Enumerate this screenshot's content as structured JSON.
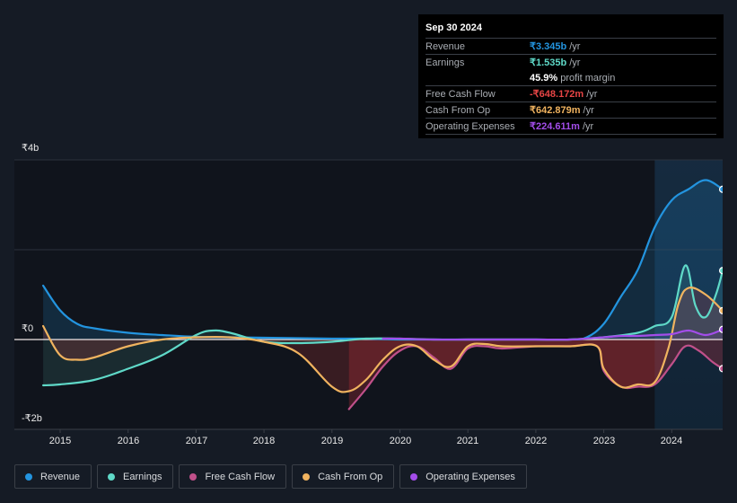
{
  "tooltip": {
    "date": "Sep 30 2024",
    "rows": [
      {
        "label": "Revenue",
        "value": "₹3.345b",
        "unit": "/yr",
        "color": "#2394df"
      },
      {
        "label": "Earnings",
        "value": "₹1.535b",
        "unit": "/yr",
        "color": "#5fd9c8"
      },
      {
        "label": "",
        "value": "45.9%",
        "unit": "profit margin",
        "color": "#ffffff"
      },
      {
        "label": "Free Cash Flow",
        "value": "-₹648.172m",
        "unit": "/yr",
        "color": "#e64545"
      },
      {
        "label": "Cash From Op",
        "value": "₹642.879m",
        "unit": "/yr",
        "color": "#f0b35f"
      },
      {
        "label": "Operating Expenses",
        "value": "₹224.611m",
        "unit": "/yr",
        "color": "#a34dea"
      }
    ]
  },
  "legend": [
    {
      "label": "Revenue",
      "color": "#2394df"
    },
    {
      "label": "Earnings",
      "color": "#5fd9c8"
    },
    {
      "label": "Free Cash Flow",
      "color": "#c0508a"
    },
    {
      "label": "Cash From Op",
      "color": "#f0b35f"
    },
    {
      "label": "Operating Expenses",
      "color": "#a34dea"
    }
  ],
  "chart_data": {
    "type": "line",
    "title": "",
    "xlabel": "",
    "ylabel": "",
    "y_unit": "INR billions",
    "ylim": [
      -2,
      4
    ],
    "xlim": [
      2014.4,
      2024.75
    ],
    "y_ticks": [
      {
        "value": 4,
        "label": "₹4b"
      },
      {
        "value": 0,
        "label": "₹0"
      },
      {
        "value": -2,
        "label": "-₹2b"
      }
    ],
    "x_ticks": [
      "2015",
      "2016",
      "2017",
      "2018",
      "2019",
      "2020",
      "2021",
      "2022",
      "2023",
      "2024"
    ],
    "highlight_from": 2023.75,
    "grid": true,
    "legend_position": "bottom-left",
    "series": [
      {
        "name": "Revenue",
        "color": "#2394df",
        "x": [
          2014.75,
          2015.0,
          2015.25,
          2015.5,
          2016.0,
          2016.5,
          2017.0,
          2017.5,
          2018.0,
          2018.5,
          2019.0,
          2019.5,
          2020.0,
          2020.5,
          2021.0,
          2021.5,
          2022.0,
          2022.5,
          2022.75,
          2023.0,
          2023.25,
          2023.5,
          2023.75,
          2024.0,
          2024.25,
          2024.5,
          2024.75
        ],
        "y": [
          1.2,
          0.65,
          0.35,
          0.25,
          0.15,
          0.1,
          0.06,
          0.05,
          0.04,
          0.03,
          0.02,
          0.02,
          0.0,
          0.0,
          0.0,
          0.0,
          0.0,
          0.0,
          0.05,
          0.35,
          0.95,
          1.55,
          2.5,
          3.1,
          3.35,
          3.55,
          3.345
        ]
      },
      {
        "name": "Earnings",
        "color": "#5fd9c8",
        "x": [
          2014.75,
          2015.0,
          2015.5,
          2016.0,
          2016.5,
          2017.0,
          2017.25,
          2017.5,
          2018.0,
          2018.5,
          2019.0,
          2019.5,
          2020.0,
          2020.5,
          2021.0,
          2021.5,
          2022.0,
          2022.5,
          2023.0,
          2023.5,
          2023.75,
          2024.0,
          2024.2,
          2024.35,
          2024.5,
          2024.65,
          2024.75
        ],
        "y": [
          -1.02,
          -1.0,
          -0.9,
          -0.65,
          -0.35,
          0.1,
          0.2,
          0.15,
          -0.05,
          -0.08,
          -0.05,
          0.02,
          0.02,
          0.0,
          0.0,
          0.0,
          0.0,
          0.0,
          0.05,
          0.15,
          0.3,
          0.5,
          1.65,
          0.75,
          0.5,
          1.0,
          1.535
        ]
      },
      {
        "name": "Free Cash Flow",
        "color": "#c0508a",
        "x": [
          2019.25,
          2019.5,
          2019.75,
          2020.0,
          2020.25,
          2020.5,
          2020.75,
          2021.0,
          2021.25,
          2021.5,
          2022.0,
          2022.5,
          2022.9,
          2023.0,
          2023.25,
          2023.5,
          2023.75,
          2024.0,
          2024.2,
          2024.4,
          2024.6,
          2024.75
        ],
        "y": [
          -1.55,
          -1.1,
          -0.6,
          -0.25,
          -0.15,
          -0.4,
          -0.65,
          -0.2,
          -0.15,
          -0.2,
          -0.15,
          -0.15,
          -0.15,
          -0.7,
          -1.05,
          -1.05,
          -1.0,
          -0.55,
          -0.15,
          -0.25,
          -0.5,
          -0.648
        ]
      },
      {
        "name": "Cash From Op",
        "color": "#f0b35f",
        "x": [
          2014.75,
          2015.0,
          2015.25,
          2015.5,
          2016.0,
          2016.5,
          2017.0,
          2017.5,
          2018.0,
          2018.5,
          2019.0,
          2019.25,
          2019.5,
          2019.75,
          2020.0,
          2020.25,
          2020.5,
          2020.75,
          2021.0,
          2021.25,
          2021.5,
          2022.0,
          2022.5,
          2022.9,
          2023.0,
          2023.25,
          2023.5,
          2023.75,
          2023.95,
          2024.1,
          2024.25,
          2024.5,
          2024.75
        ],
        "y": [
          0.3,
          -0.35,
          -0.45,
          -0.4,
          -0.15,
          0.0,
          0.05,
          0.05,
          -0.05,
          -0.3,
          -1.05,
          -1.15,
          -0.9,
          -0.45,
          -0.15,
          -0.15,
          -0.45,
          -0.6,
          -0.15,
          -0.1,
          -0.15,
          -0.15,
          -0.15,
          -0.15,
          -0.65,
          -1.05,
          -1.0,
          -0.95,
          -0.2,
          0.8,
          1.15,
          1.0,
          0.643
        ]
      },
      {
        "name": "Operating Expenses",
        "color": "#a34dea",
        "x": [
          2019.75,
          2020.0,
          2020.5,
          2021.0,
          2021.5,
          2022.0,
          2022.5,
          2023.0,
          2023.25,
          2023.5,
          2023.75,
          2024.0,
          2024.25,
          2024.5,
          2024.75
        ],
        "y": [
          0.02,
          0.02,
          0.0,
          0.0,
          0.0,
          0.0,
          0.0,
          0.05,
          0.08,
          0.08,
          0.1,
          0.12,
          0.2,
          0.1,
          0.225
        ]
      }
    ]
  }
}
